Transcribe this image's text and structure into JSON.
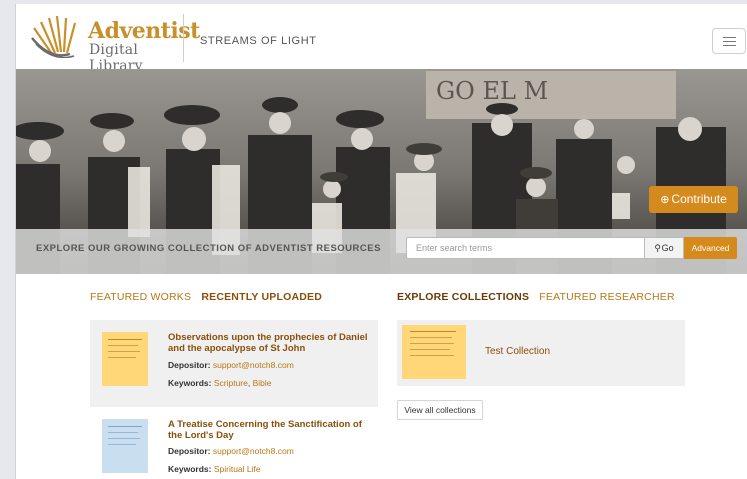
{
  "header": {
    "logo_line1": "Adventist",
    "logo_line2": "Digital Library",
    "site_name": "STREAMS OF LIGHT"
  },
  "hero": {
    "contribute_label": "Contribute",
    "explore_text": "EXPLORE OUR GROWING COLLECTION OF ADVENTIST RESOURCES",
    "search_placeholder": "Enter search terms",
    "go_label": "Go",
    "advanced_label": "Advanced",
    "banner_sign_text": "GO EL M"
  },
  "left_tabs": [
    "FEATURED WORKS",
    "RECENTLY UPLOADED"
  ],
  "right_tabs": [
    "EXPLORE COLLECTIONS",
    "FEATURED RESEARCHER"
  ],
  "works": [
    {
      "title": "Observations upon the prophecies of Daniel and the apocalypse of St John",
      "depositor_label": "Depositor:",
      "depositor": "support@notch8.com",
      "keywords_label": "Keywords:",
      "keywords": [
        "Scripture",
        "Bible"
      ],
      "thumb_color": "#ffd778"
    },
    {
      "title": "A Treatise Concerning the Sanctification of the Lord's Day",
      "depositor_label": "Depositor:",
      "depositor": "support@notch8.com",
      "keywords_label": "Keywords:",
      "keywords": [
        "Spiritual Life"
      ],
      "thumb_color": "#c9dff0"
    }
  ],
  "collection": {
    "title": "Test Collection",
    "view_all_label": "View all collections"
  },
  "colors": {
    "accent_orange": "#d58a1d",
    "link_brown": "#8a4f0a",
    "link_gold": "#b87715"
  }
}
